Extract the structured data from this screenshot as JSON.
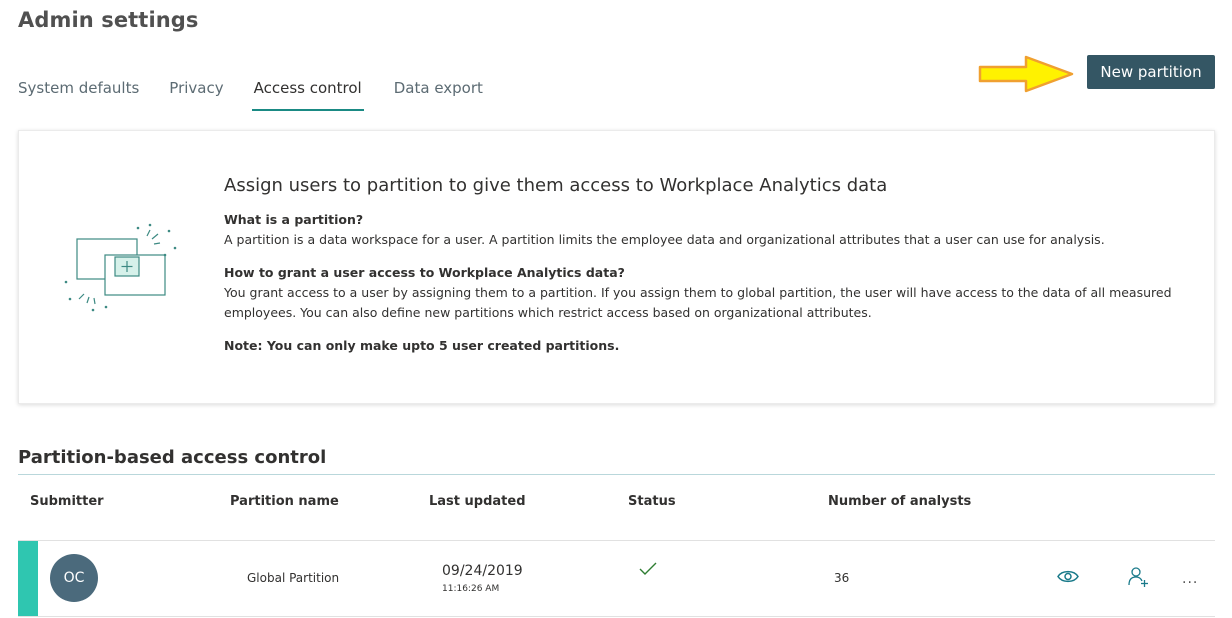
{
  "page": {
    "title": "Admin settings"
  },
  "tabs": [
    {
      "label": "System defaults",
      "active": false
    },
    {
      "label": "Privacy",
      "active": false
    },
    {
      "label": "Access control",
      "active": true
    },
    {
      "label": "Data export",
      "active": false
    }
  ],
  "actions": {
    "new_partition_label": "New partition",
    "arrow_color": "#ffef00"
  },
  "info_card": {
    "heading": "Assign users to partition to give them access to Workplace Analytics data",
    "q1": "What is a partition?",
    "a1": "A partition is a data workspace for a user. A partition limits the employee data and organizational attributes that a user can use for analysis.",
    "q2": "How to grant a user access to Workplace Analytics data?",
    "a2": "You grant access to a user by assigning them to a partition. If you assign them to global partition, the user will have access to the data of all measured employees. You can also define new partitions which restrict access based on organizational attributes.",
    "note": "Note: You can only make upto 5 user created partitions."
  },
  "section": {
    "title": "Partition-based access control"
  },
  "table": {
    "columns": [
      "Submitter",
      "Partition name",
      "Last updated",
      "Status",
      "Number of analysts"
    ],
    "rows": [
      {
        "submitter_initials": "OC",
        "partition_name": "Global Partition",
        "last_updated_date": "09/24/2019",
        "last_updated_time": "11:16:26 AM",
        "status_icon": "checkmark-icon",
        "analysts": "36",
        "actions": [
          "view-icon",
          "add-user-icon",
          "more-options-icon"
        ],
        "more_label": "..."
      }
    ]
  },
  "colors": {
    "accent": "#1a8a84",
    "button_bg": "#345664",
    "row_accent": "#2fc6b0",
    "avatar_bg": "#4b6a7c"
  }
}
